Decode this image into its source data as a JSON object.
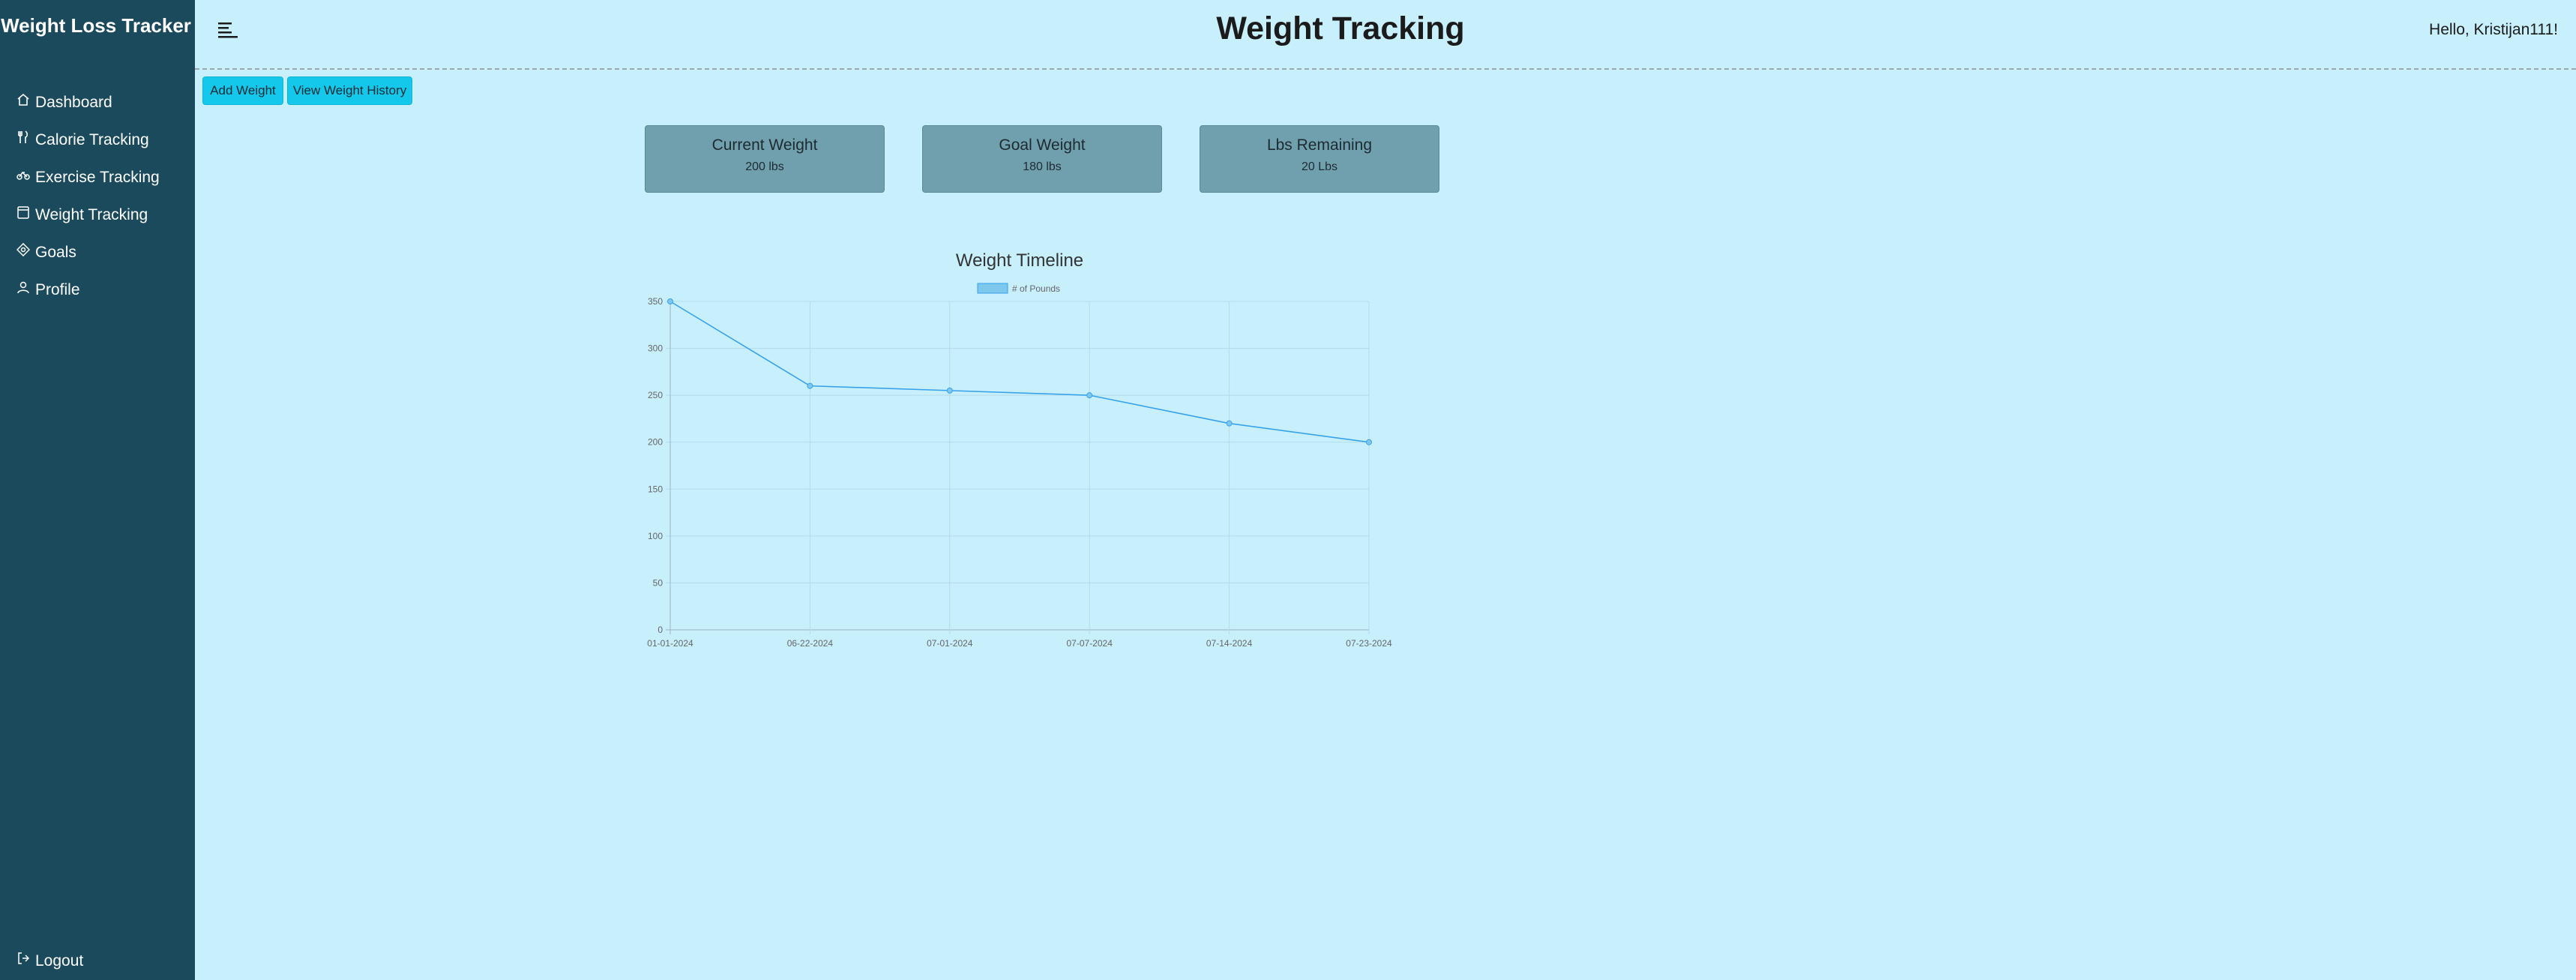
{
  "sidebar": {
    "brand": "Weight Loss Tracker",
    "items": [
      {
        "label": "Dashboard",
        "icon": "home-icon"
      },
      {
        "label": "Calorie Tracking",
        "icon": "utensils-icon"
      },
      {
        "label": "Exercise Tracking",
        "icon": "bicycle-icon"
      },
      {
        "label": "Weight Tracking",
        "icon": "scale-icon"
      },
      {
        "label": "Goals",
        "icon": "target-icon"
      },
      {
        "label": "Profile",
        "icon": "person-icon"
      }
    ],
    "logout": "Logout"
  },
  "header": {
    "title": "Weight Tracking",
    "greeting": "Hello, Kristijan111!"
  },
  "actions": {
    "add_weight": "Add Weight",
    "view_history": "View Weight History"
  },
  "cards": [
    {
      "title": "Current Weight",
      "value": "200 lbs"
    },
    {
      "title": "Goal Weight",
      "value": "180 lbs"
    },
    {
      "title": "Lbs Remaining",
      "value": "20 Lbs"
    }
  ],
  "colors": {
    "sidebar": "#1a4a5c",
    "background": "#c8effc",
    "button": "#14c8ec",
    "card": "#70a0ae",
    "series": "#36a2eb"
  },
  "chart_data": {
    "type": "line",
    "title": "Weight Timeline",
    "categories": [
      "01-01-2024",
      "06-22-2024",
      "07-01-2024",
      "07-07-2024",
      "07-14-2024",
      "07-23-2024"
    ],
    "series": [
      {
        "name": "# of Pounds",
        "values": [
          350,
          260,
          255,
          250,
          220,
          200
        ]
      }
    ],
    "yticks": [
      "0",
      "50",
      "100",
      "150",
      "200",
      "250",
      "300",
      "350"
    ],
    "ylim": [
      0,
      350
    ],
    "grid": true,
    "legend": "top"
  }
}
